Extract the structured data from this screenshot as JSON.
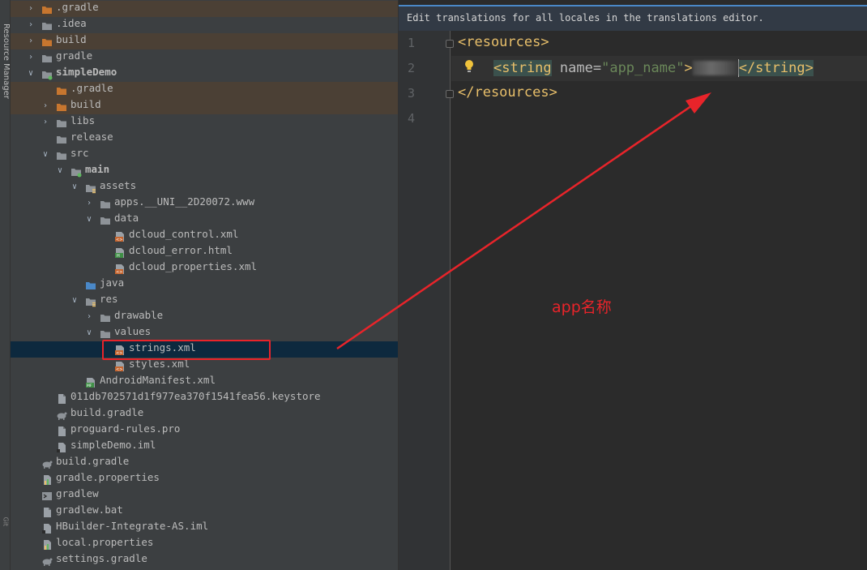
{
  "sidebar_stripe": {
    "label": "Resource Manager",
    "bottom_label": "Git"
  },
  "tree": [
    {
      "label": ".gradle",
      "depth": 1,
      "arrow": "right",
      "icon": "folder-icon",
      "excluded": true
    },
    {
      "label": ".idea",
      "depth": 1,
      "arrow": "right",
      "icon": "folder-icon"
    },
    {
      "label": "build",
      "depth": 1,
      "arrow": "right",
      "icon": "folder-icon",
      "excluded": true
    },
    {
      "label": "gradle",
      "depth": 1,
      "arrow": "right",
      "icon": "folder-icon"
    },
    {
      "label": "simpleDemo",
      "depth": 1,
      "arrow": "down",
      "icon": "module-folder-icon",
      "bold": true
    },
    {
      "label": ".gradle",
      "depth": 2,
      "arrow": "none",
      "icon": "folder-icon",
      "excluded": true
    },
    {
      "label": "build",
      "depth": 2,
      "arrow": "right",
      "icon": "folder-icon",
      "excluded": true
    },
    {
      "label": "libs",
      "depth": 2,
      "arrow": "right",
      "icon": "folder-icon"
    },
    {
      "label": "release",
      "depth": 2,
      "arrow": "none",
      "icon": "folder-icon"
    },
    {
      "label": "src",
      "depth": 2,
      "arrow": "down",
      "icon": "folder-icon"
    },
    {
      "label": "main",
      "depth": 3,
      "arrow": "down",
      "icon": "source-folder-icon",
      "bold": true
    },
    {
      "label": "assets",
      "depth": 4,
      "arrow": "down",
      "icon": "resource-folder-icon"
    },
    {
      "label": "apps.__UNI__2D20072.www",
      "depth": 5,
      "arrow": "right",
      "icon": "folder-icon"
    },
    {
      "label": "data",
      "depth": 5,
      "arrow": "down",
      "icon": "folder-icon"
    },
    {
      "label": "dcloud_control.xml",
      "depth": 6,
      "arrow": "none",
      "icon": "xml-file-icon"
    },
    {
      "label": "dcloud_error.html",
      "depth": 6,
      "arrow": "none",
      "icon": "html-file-icon"
    },
    {
      "label": "dcloud_properties.xml",
      "depth": 6,
      "arrow": "none",
      "icon": "xml-file-icon"
    },
    {
      "label": "java",
      "depth": 4,
      "arrow": "none",
      "icon": "java-folder-icon"
    },
    {
      "label": "res",
      "depth": 4,
      "arrow": "down",
      "icon": "resource-folder-icon"
    },
    {
      "label": "drawable",
      "depth": 5,
      "arrow": "right",
      "icon": "folder-icon"
    },
    {
      "label": "values",
      "depth": 5,
      "arrow": "down",
      "icon": "folder-icon"
    },
    {
      "label": "strings.xml",
      "depth": 6,
      "arrow": "none",
      "icon": "xml-file-icon",
      "selected": true
    },
    {
      "label": "styles.xml",
      "depth": 6,
      "arrow": "none",
      "icon": "xml-file-icon"
    },
    {
      "label": "AndroidManifest.xml",
      "depth": 4,
      "arrow": "none",
      "icon": "manifest-file-icon"
    },
    {
      "label": "011db702571d1f977ea370f1541fea56.keystore",
      "depth": 2,
      "arrow": "none",
      "icon": "file-icon"
    },
    {
      "label": "build.gradle",
      "depth": 2,
      "arrow": "none",
      "icon": "gradle-icon"
    },
    {
      "label": "proguard-rules.pro",
      "depth": 2,
      "arrow": "none",
      "icon": "file-icon"
    },
    {
      "label": "simpleDemo.iml",
      "depth": 2,
      "arrow": "none",
      "icon": "iml-file-icon"
    },
    {
      "label": "build.gradle",
      "depth": 1,
      "arrow": "none",
      "icon": "gradle-icon"
    },
    {
      "label": "gradle.properties",
      "depth": 1,
      "arrow": "none",
      "icon": "properties-file-icon"
    },
    {
      "label": "gradlew",
      "depth": 1,
      "arrow": "none",
      "icon": "shell-file-icon"
    },
    {
      "label": "gradlew.bat",
      "depth": 1,
      "arrow": "none",
      "icon": "file-icon"
    },
    {
      "label": "HBuilder-Integrate-AS.iml",
      "depth": 1,
      "arrow": "none",
      "icon": "iml-file-icon"
    },
    {
      "label": "local.properties",
      "depth": 1,
      "arrow": "none",
      "icon": "properties-file-icon"
    },
    {
      "label": "settings.gradle",
      "depth": 1,
      "arrow": "none",
      "icon": "gradle-icon"
    }
  ],
  "editor": {
    "banner": "Edit translations for all locales in the translations editor.",
    "line_numbers": [
      "1",
      "2",
      "3",
      "4"
    ],
    "line1": "<resources>",
    "line2_open_tag": "<string",
    "line2_attr_name": " name",
    "line2_eq": "=",
    "line2_attr_value": "\"app_name\"",
    "line2_gt": ">",
    "line2_close_tag": "</string>",
    "line3": "</resources>"
  },
  "annotation": {
    "text": "app名称",
    "color": "#e8242a"
  },
  "colors": {
    "tree_bg": "#3c3f41",
    "excluded_bg": "#4b4035",
    "selected_bg": "#0d293e",
    "editor_bg": "#2b2b2b",
    "xml_tag": "#e8bf6a",
    "xml_value": "#6a8759",
    "highlight_red": "#e8242a"
  }
}
